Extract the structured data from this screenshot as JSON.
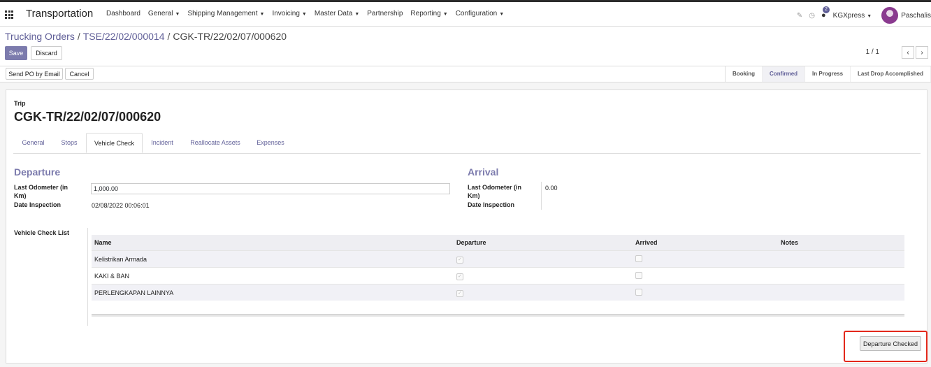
{
  "navbar": {
    "app_title": "Transportation",
    "menu": [
      {
        "label": "Dashboard",
        "dropdown": false
      },
      {
        "label": "General",
        "dropdown": true
      },
      {
        "label": "Shipping Management",
        "dropdown": true
      },
      {
        "label": "Invoicing",
        "dropdown": true
      },
      {
        "label": "Master Data",
        "dropdown": true
      },
      {
        "label": "Partnership",
        "dropdown": false
      },
      {
        "label": "Reporting",
        "dropdown": true
      },
      {
        "label": "Configuration",
        "dropdown": true
      }
    ],
    "chat_badge": "2",
    "company": "KGXpress",
    "user": "Paschalis",
    "icons": [
      "apps-grid-icon",
      "edit-icon",
      "clock-icon",
      "chat-icon",
      "avatar"
    ]
  },
  "breadcrumb": {
    "root": "Trucking Orders",
    "parent": "TSE/22/02/000014",
    "current": "CGK-TR/22/02/07/000620"
  },
  "actions": {
    "save": "Save",
    "discard": "Discard"
  },
  "pager": {
    "value": "1 / 1",
    "prev": "‹",
    "next": "›"
  },
  "header_buttons": {
    "send_po": "Send PO by Email",
    "cancel": "Cancel"
  },
  "stages": [
    {
      "label": "Booking",
      "active": false
    },
    {
      "label": "Confirmed",
      "active": true
    },
    {
      "label": "In Progress",
      "active": false
    },
    {
      "label": "Last Drop Accomplished",
      "active": false
    }
  ],
  "form": {
    "trip_label": "Trip",
    "trip_name": "CGK-TR/22/02/07/000620",
    "tabs": [
      "General",
      "Stops",
      "Vehicle Check",
      "Incident",
      "Reallocate Assets",
      "Expenses"
    ],
    "active_tab": "Vehicle Check",
    "departure": {
      "title": "Departure",
      "odometer_label": "Last Odometer (in Km)",
      "odometer_value": "1,000.00",
      "date_label": "Date Inspection",
      "date_value": "02/08/2022 00:06:01"
    },
    "arrival": {
      "title": "Arrival",
      "odometer_label": "Last Odometer (in Km)",
      "odometer_value": "0.00",
      "date_label": "Date Inspection",
      "date_value": ""
    },
    "checklist": {
      "label": "Vehicle Check List",
      "columns": [
        "Name",
        "Departure",
        "Arrived",
        "Notes"
      ],
      "rows": [
        {
          "name": "Kelistrikan Armada",
          "departure": true,
          "arrived": false,
          "notes": ""
        },
        {
          "name": "KAKI & BAN",
          "departure": true,
          "arrived": false,
          "notes": ""
        },
        {
          "name": "PERLENGKAPAN LAINNYA",
          "departure": true,
          "arrived": false,
          "notes": ""
        }
      ]
    },
    "departure_checked_button": "Departure Checked"
  },
  "colors": {
    "accent": "#7c7bad",
    "link": "#5f5e97",
    "highlight": "#e3281b"
  }
}
